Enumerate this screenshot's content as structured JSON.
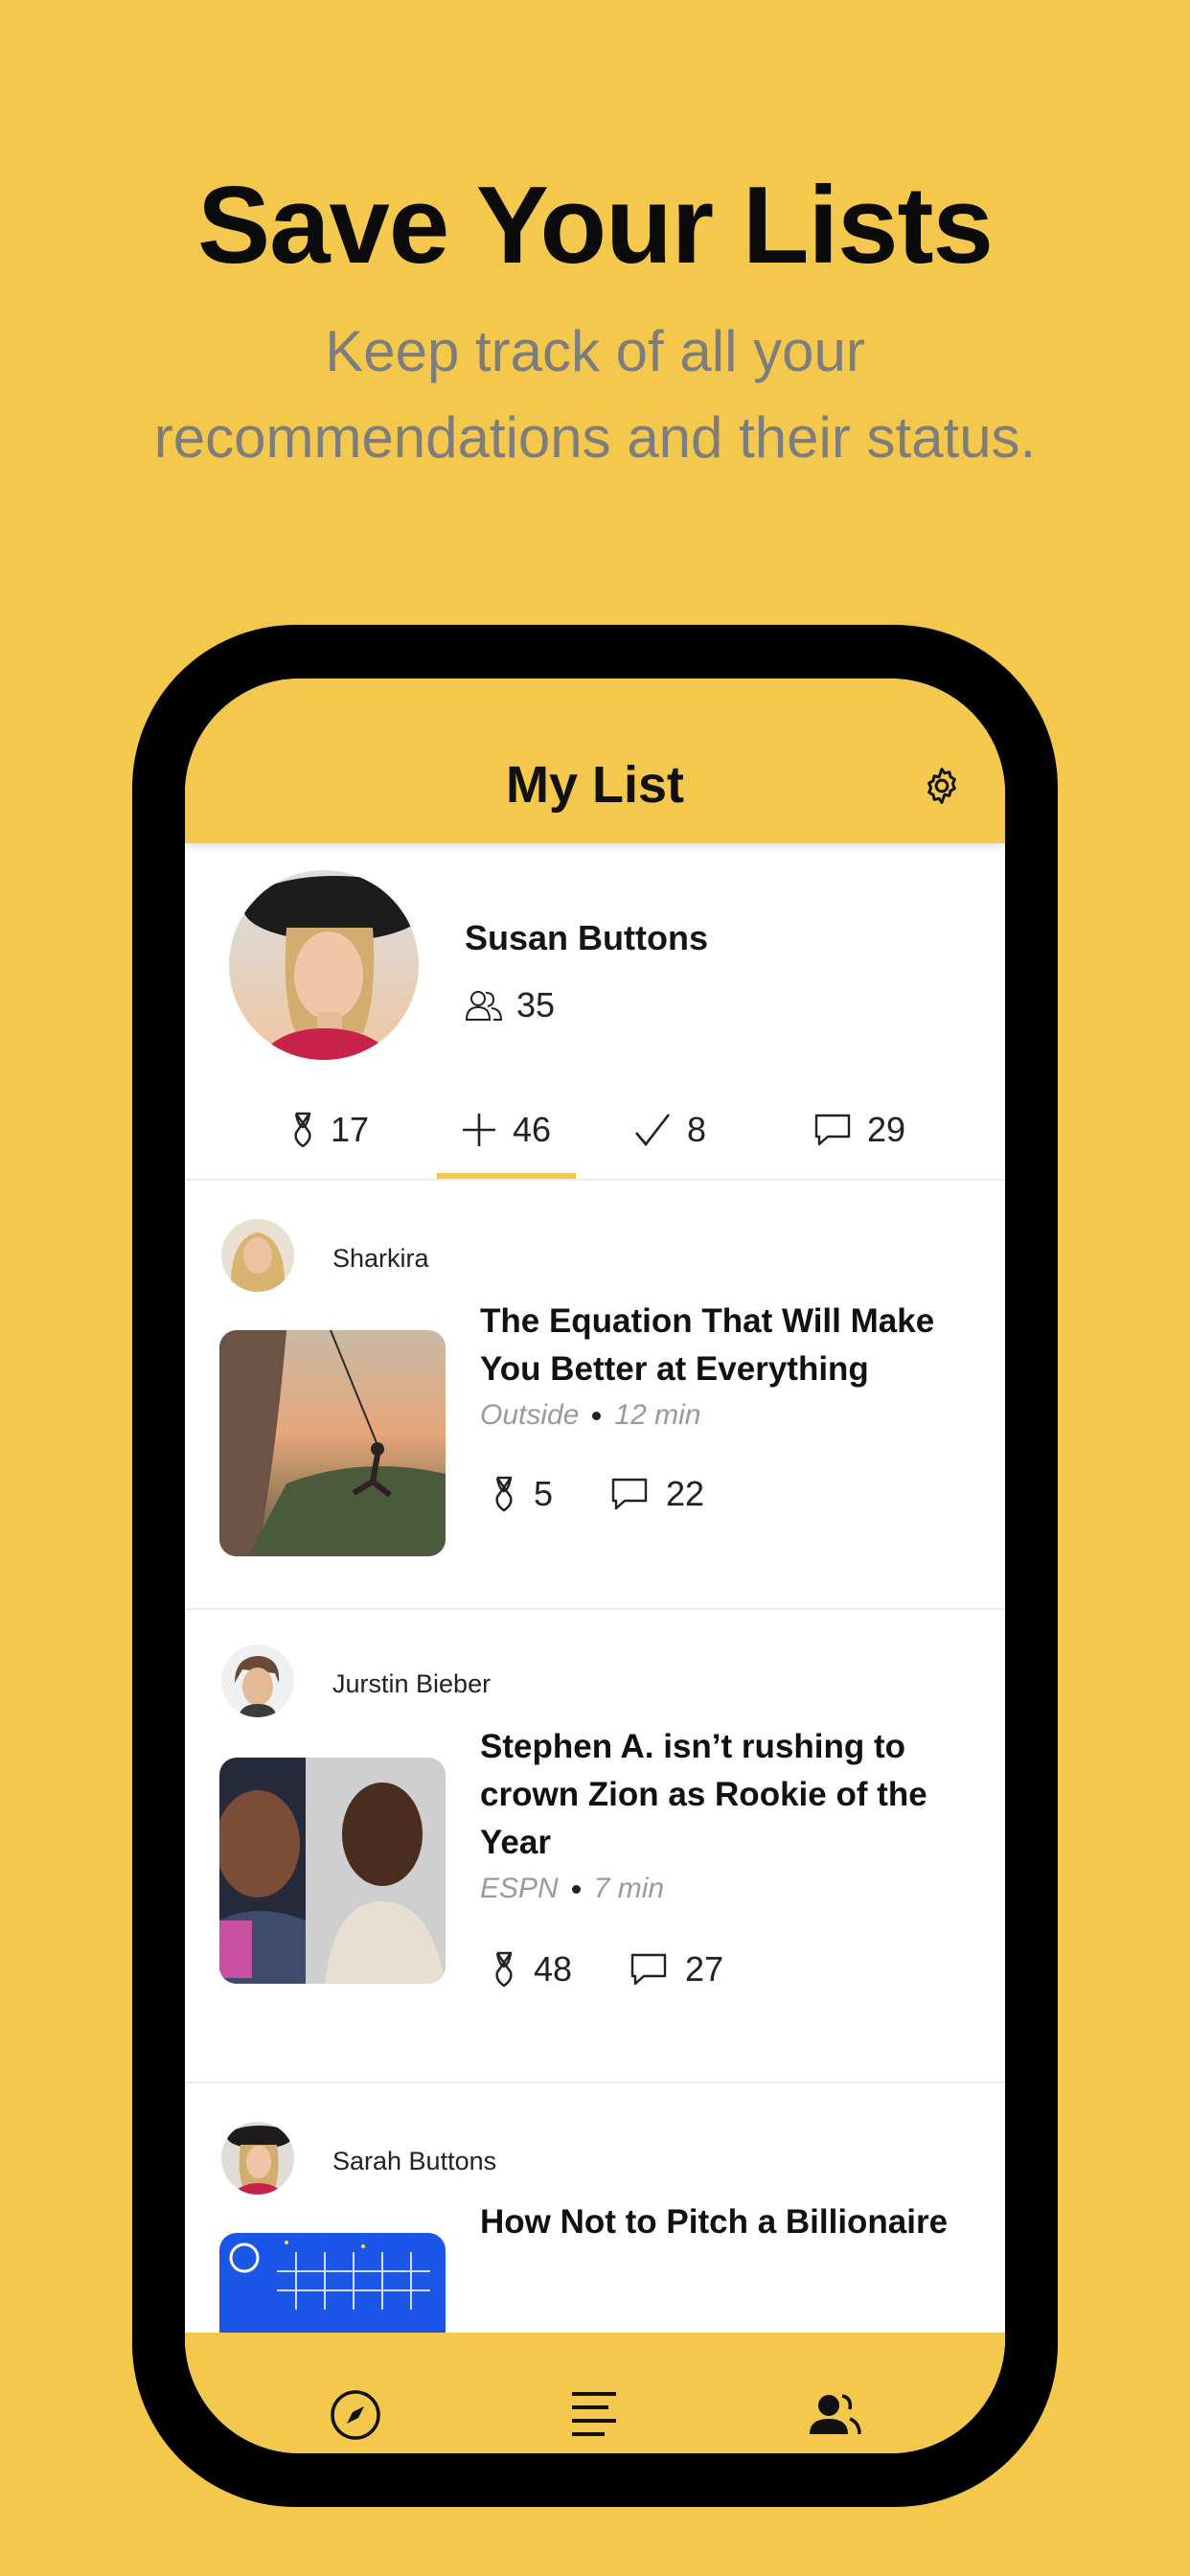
{
  "marketing": {
    "headline": "Save Your Lists",
    "subline_1": "Keep track of all your",
    "subline_2": "recommendations and their status."
  },
  "app": {
    "title": "My List",
    "settings_icon": "gear-icon",
    "profile": {
      "name": "Susan Buttons",
      "followers": "35"
    },
    "stats": [
      {
        "icon": "recommend-icon",
        "value": "17"
      },
      {
        "icon": "plus-icon",
        "value": "46"
      },
      {
        "icon": "check-icon",
        "value": "8"
      },
      {
        "icon": "comment-icon",
        "value": "29"
      }
    ],
    "active_stat": 1,
    "feed": [
      {
        "author": "Sharkira",
        "title_1": "The Equation That Will Make",
        "title_2": "You Better at Everything",
        "title_3": "",
        "source": "Outside",
        "duration": "12 min",
        "recommends": "5",
        "comments": "22"
      },
      {
        "author": "Jurstin Bieber",
        "title_1": "Stephen A. isn’t rushing to",
        "title_2": "crown Zion as Rookie of the",
        "title_3": "Year",
        "source": "ESPN",
        "duration": "7 min",
        "recommends": "48",
        "comments": "27"
      },
      {
        "author": "Sarah Buttons",
        "title_1": "How Not to Pitch a Billionaire"
      }
    ],
    "tabbar": [
      "compass-icon",
      "list-icon",
      "profile-icon"
    ],
    "colors": {
      "accent": "#F3C84C",
      "text": "#111111",
      "muted": "#9a9a9a"
    }
  }
}
